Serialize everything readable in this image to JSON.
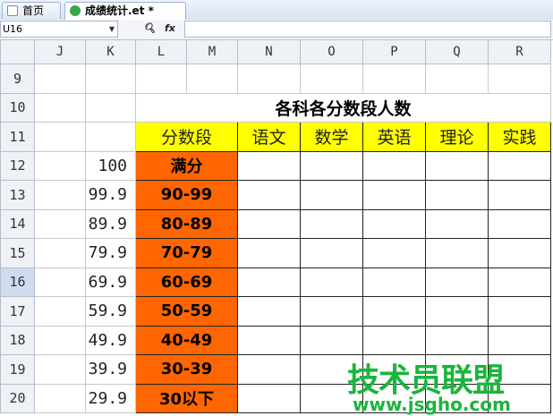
{
  "tabs": [
    {
      "label": "首页",
      "icon": "sheet-icon"
    },
    {
      "label": "成绩统计.et *",
      "icon": "et-file-icon"
    }
  ],
  "formula_bar": {
    "name_box": "U16",
    "zoom_icon": "magnifier-icon",
    "fx_label": "fx",
    "formula": ""
  },
  "columns": [
    "J",
    "K",
    "L",
    "M",
    "N",
    "O",
    "P",
    "Q",
    "R"
  ],
  "rows": [
    {
      "num": "9"
    },
    {
      "num": "10"
    },
    {
      "num": "11"
    },
    {
      "num": "12",
      "k": "100",
      "l": "满分"
    },
    {
      "num": "13",
      "k": "99.9",
      "l": "90-99"
    },
    {
      "num": "14",
      "k": "89.9",
      "l": "80-89"
    },
    {
      "num": "15",
      "k": "79.9",
      "l": "70-79"
    },
    {
      "num": "16",
      "k": "69.9",
      "l": "60-69"
    },
    {
      "num": "17",
      "k": "59.9",
      "l": "50-59"
    },
    {
      "num": "18",
      "k": "49.9",
      "l": "40-49"
    },
    {
      "num": "19",
      "k": "39.9",
      "l": "30-39"
    },
    {
      "num": "20",
      "k": "29.9",
      "l": "30以下"
    }
  ],
  "table": {
    "title": "各科各分数段人数",
    "header_first": "分数段",
    "subjects": [
      "语文",
      "数学",
      "英语",
      "理论",
      "实践"
    ]
  },
  "active_row": "16",
  "colors": {
    "header_fill": "#ffff00",
    "range_fill": "#ff6600",
    "watermark": "#1ab53c"
  },
  "watermark": {
    "title": "技术员联盟",
    "url": "www.jsgho.com"
  }
}
